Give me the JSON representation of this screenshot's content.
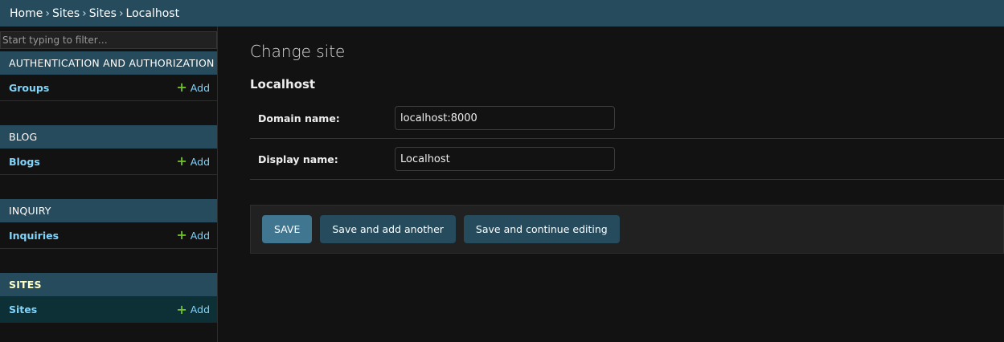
{
  "breadcrumbs": {
    "items": [
      "Home",
      "Sites",
      "Sites",
      "Localhost"
    ],
    "separator": "›"
  },
  "sidebar": {
    "filter_placeholder": "Start typing to filter…",
    "modules": [
      {
        "name": "AUTHENTICATION AND AUTHORIZATION",
        "models": [
          {
            "label": "Groups",
            "add_label": "Add"
          }
        ]
      },
      {
        "name": "BLOG",
        "models": [
          {
            "label": "Blogs",
            "add_label": "Add"
          }
        ]
      },
      {
        "name": "INQUIRY",
        "models": [
          {
            "label": "Inquiries",
            "add_label": "Add"
          }
        ]
      },
      {
        "name": "SITES",
        "current": true,
        "models": [
          {
            "label": "Sites",
            "add_label": "Add",
            "current": true
          }
        ]
      }
    ],
    "add_icon": "plus-icon"
  },
  "main": {
    "title": "Change site",
    "object_title": "Localhost",
    "fields": [
      {
        "label": "Domain name:",
        "value": "localhost:8000"
      },
      {
        "label": "Display name:",
        "value": "Localhost"
      }
    ],
    "buttons": {
      "save": "SAVE",
      "save_add_another": "Save and add another",
      "save_continue": "Save and continue editing"
    }
  },
  "colors": {
    "header_bg": "#264b5d",
    "page_bg": "#121212",
    "link": "#81d4fa",
    "add_icon": "#70bf2b",
    "primary_button": "#417690",
    "secondary_button": "#264b5d",
    "current_model_bg": "#0d2f36"
  }
}
